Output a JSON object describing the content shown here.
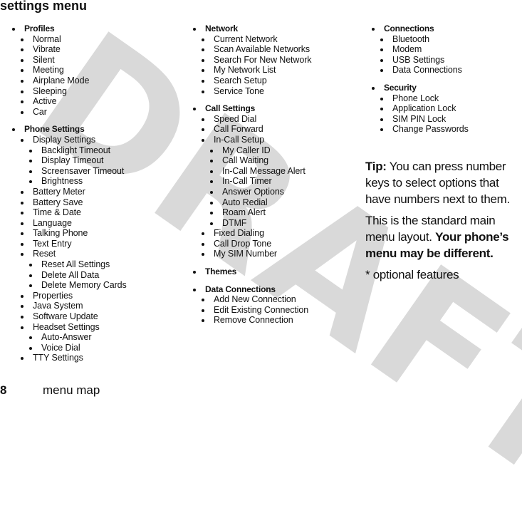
{
  "page": {
    "title": "settings menu",
    "watermark": "DRAFT",
    "footer": {
      "page_number": "8",
      "section": "menu map"
    }
  },
  "columns": [
    {
      "groups": [
        {
          "label": "Profiles",
          "items": [
            {
              "label": "Normal"
            },
            {
              "label": "Vibrate"
            },
            {
              "label": "Silent"
            },
            {
              "label": "Meeting"
            },
            {
              "label": "Airplane Mode"
            },
            {
              "label": "Sleeping"
            },
            {
              "label": "Active"
            },
            {
              "label": "Car"
            }
          ]
        },
        {
          "label": "Phone Settings",
          "items": [
            {
              "label": "Display Settings",
              "children": [
                "Backlight Timeout",
                "Display Timeout",
                "Screensaver Timeout",
                "Brightness"
              ]
            },
            {
              "label": "Battery Meter"
            },
            {
              "label": "Battery Save"
            },
            {
              "label": "Time & Date"
            },
            {
              "label": "Language"
            },
            {
              "label": "Talking Phone"
            },
            {
              "label": "Text Entry"
            },
            {
              "label": "Reset",
              "children": [
                "Reset All Settings",
                "Delete All Data",
                "Delete Memory Cards"
              ]
            },
            {
              "label": "Properties"
            },
            {
              "label": "Java System"
            },
            {
              "label": "Software Update"
            },
            {
              "label": "Headset Settings",
              "children": [
                "Auto-Answer",
                "Voice Dial"
              ]
            },
            {
              "label": "TTY Settings"
            }
          ]
        }
      ]
    },
    {
      "groups": [
        {
          "label": "Network",
          "items": [
            {
              "label": "Current Network"
            },
            {
              "label": "Scan Available Networks"
            },
            {
              "label": "Search For New Network"
            },
            {
              "label": "My Network List"
            },
            {
              "label": "Search Setup"
            },
            {
              "label": "Service Tone"
            }
          ]
        },
        {
          "label": "Call Settings",
          "items": [
            {
              "label": "Speed Dial"
            },
            {
              "label": "Call Forward"
            },
            {
              "label": "In-Call Setup",
              "children": [
                "My Caller ID",
                "Call Waiting",
                "In-Call Message Alert",
                "In-Call Timer",
                "Answer Options",
                "Auto Redial",
                "Roam Alert",
                "DTMF"
              ]
            },
            {
              "label": "Fixed Dialing"
            },
            {
              "label": "Call Drop Tone"
            },
            {
              "label": "My SIM Number"
            }
          ]
        },
        {
          "label": "Themes",
          "items": []
        },
        {
          "label": "Data Connections",
          "items": [
            {
              "label": "Add New Connection"
            },
            {
              "label": "Edit Existing Connection"
            },
            {
              "label": "Remove Connection"
            }
          ]
        }
      ]
    },
    {
      "groups": [
        {
          "label": "Connections",
          "items": [
            {
              "label": "Bluetooth"
            },
            {
              "label": "Modem"
            },
            {
              "label": "USB Settings"
            },
            {
              "label": "Data Connections"
            }
          ]
        },
        {
          "label": "Security",
          "items": [
            {
              "label": "Phone Lock"
            },
            {
              "label": "Application Lock"
            },
            {
              "label": "SIM PIN Lock"
            },
            {
              "label": "Change Passwords"
            }
          ]
        }
      ]
    }
  ],
  "notes": {
    "tip_label": "Tip:",
    "tip_text": " You can press number keys to select options that have numbers next to them.",
    "standard_text": "This is the standard main menu layout. ",
    "standard_bold": "Your phone’s menu may be different.",
    "optional": "* optional features"
  }
}
